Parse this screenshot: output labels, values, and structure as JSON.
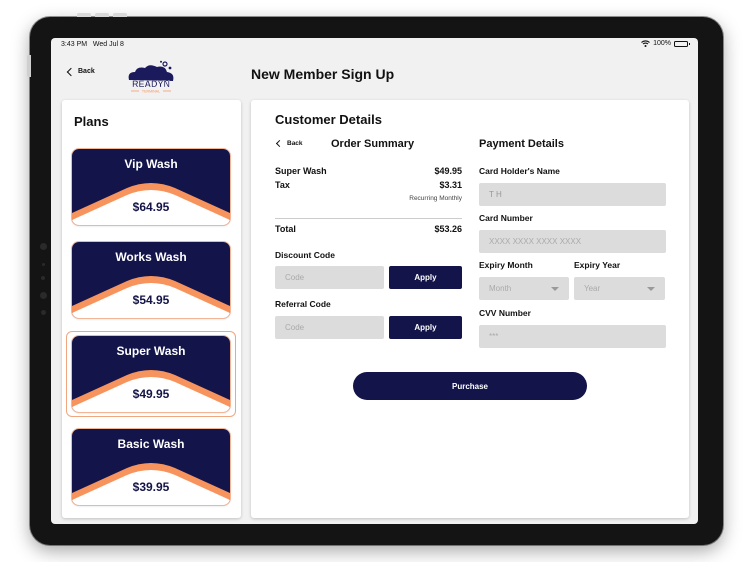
{
  "status_bar": {
    "time": "3:43 PM",
    "date": "Wed Jul 8",
    "battery_text": "100%",
    "battery_level": 1.0,
    "wifi_icon": "wifi-icon"
  },
  "header": {
    "back_label": "Back",
    "logo_text": "READYN",
    "logo_subtext": "TERMINAL",
    "title": "New Member Sign Up"
  },
  "plans": {
    "title": "Plans",
    "selected_index": 2,
    "items": [
      {
        "name": "Vip Wash",
        "price": "$64.95"
      },
      {
        "name": "Works Wash",
        "price": "$54.95"
      },
      {
        "name": "Super Wash",
        "price": "$49.95"
      },
      {
        "name": "Basic Wash",
        "price": "$39.95"
      }
    ]
  },
  "customer_details": {
    "title": "Customer Details",
    "order_summary": {
      "back_label": "Back",
      "title": "Order Summary",
      "line_items": [
        {
          "label": "Super Wash",
          "value": "$49.95"
        },
        {
          "label": "Tax",
          "value": "$3.31"
        }
      ],
      "recurring_note": "Recurring Monthly",
      "total_label": "Total",
      "total_value": "$53.26"
    },
    "discount": {
      "label": "Discount Code",
      "placeholder": "Code",
      "value": "",
      "apply_label": "Apply"
    },
    "referral": {
      "label": "Referral Code",
      "placeholder": "Code",
      "value": "",
      "apply_label": "Apply"
    }
  },
  "payment_details": {
    "title": "Payment Details",
    "card_holder": {
      "label": "Card Holder's Name",
      "value": "T H"
    },
    "card_number": {
      "label": "Card Number",
      "placeholder": "XXXX XXXX XXXX XXXX"
    },
    "expiry_month": {
      "label": "Expiry Month",
      "placeholder": "Month"
    },
    "expiry_year": {
      "label": "Expiry Year",
      "placeholder": "Year"
    },
    "cvv": {
      "label": "CVV Number",
      "placeholder": "***"
    }
  },
  "purchase_label": "Purchase",
  "colors": {
    "navy": "#12144a",
    "orange": "#f7945e",
    "input_bg": "#dcdcdc",
    "screen_bg": "#f1f1f1"
  }
}
